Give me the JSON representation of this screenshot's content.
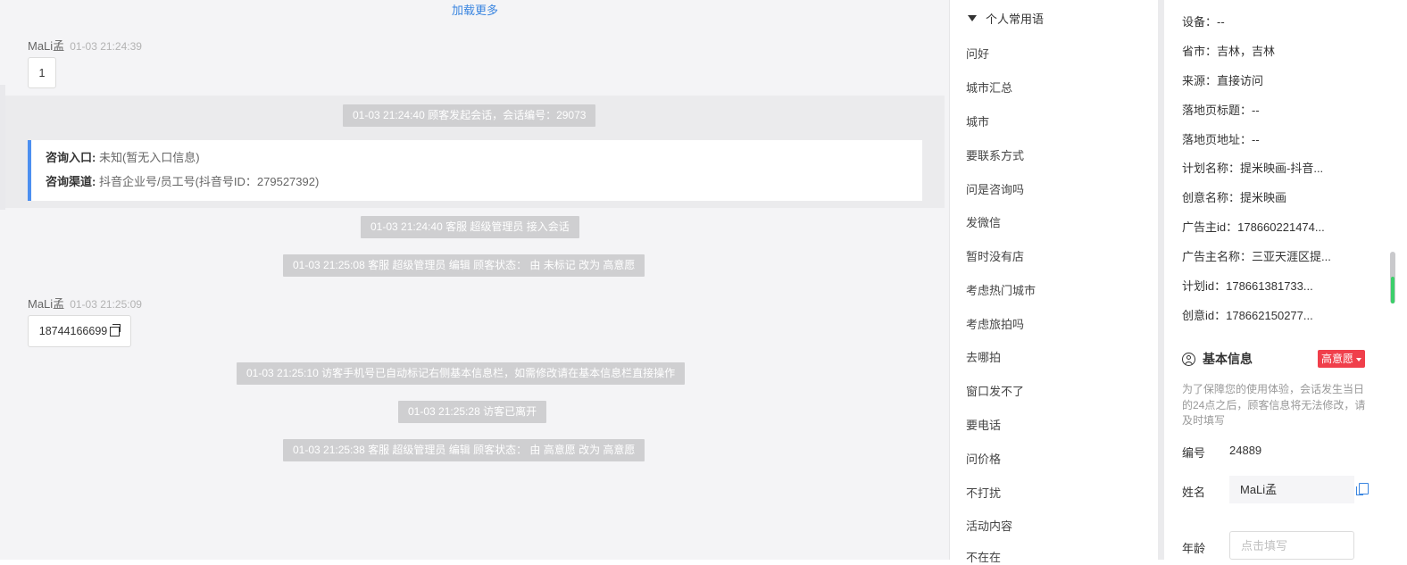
{
  "chat": {
    "load_more": "加载更多",
    "msg1": {
      "sender": "MaLi孟",
      "time": "01-03 21:24:39",
      "text": "1"
    },
    "sys1": "01-03 21:24:40 顾客发起会话，会话编号：29073",
    "entry": {
      "entrance_label": "咨询入口:",
      "entrance_value": "未知(暂无入口信息)",
      "channel_label": "咨询渠道:",
      "channel_value": "抖音企业号/员工号(抖音号ID：279527392)"
    },
    "sys2": "01-03 21:24:40 客服 超级管理员 接入会话",
    "sys3": "01-03 21:25:08 客服 超级管理员 编辑 顾客状态：  由 未标记 改为 高意愿",
    "msg2": {
      "sender": "MaLi孟",
      "time": "01-03 21:25:09",
      "text": "18744166699"
    },
    "sys4": "01-03 21:25:10 访客手机号已自动标记右侧基本信息栏，如需修改请在基本信息栏直接操作",
    "sys5": "01-03 21:25:28 访客已离开",
    "sys6": "01-03 21:25:38 客服 超级管理员 编辑 顾客状态：  由 高意愿 改为 高意愿"
  },
  "phrases": {
    "header": "个人常用语",
    "items": [
      "问好",
      "城市汇总",
      "城市",
      "要联系方式",
      "问是咨询吗",
      "发微信",
      "暂时没有店",
      "考虑热门城市",
      "考虑旅拍吗",
      "去哪拍",
      "窗口发不了",
      "要电话",
      "问价格",
      "不打扰",
      "活动内容",
      "不在在"
    ]
  },
  "info": {
    "device": "设备：--",
    "province": "省市：吉林，吉林",
    "source": "来源：直接访问",
    "landing_title": "落地页标题：--",
    "landing_url": "落地页地址：--",
    "plan_name": "计划名称：提米映画-抖音...",
    "creative_name": "创意名称：提米映画",
    "advertiser_id": "广告主id：178660221474...",
    "advertiser_name": "广告主名称：三亚天涯区提...",
    "plan_id": "计划id：178661381733...",
    "creative_id": "创意id：178662150277...",
    "basic_title": "基本信息",
    "intent_badge": "高意愿",
    "notice": "为了保障您的使用体验，会话发生当日的24点之后，顾客信息将无法修改，请及时填写",
    "number_label": "编号",
    "number_value": "24889",
    "name_label": "姓名",
    "name_value": "MaLi孟",
    "age_label": "年龄",
    "age_placeholder": "点击填写"
  }
}
